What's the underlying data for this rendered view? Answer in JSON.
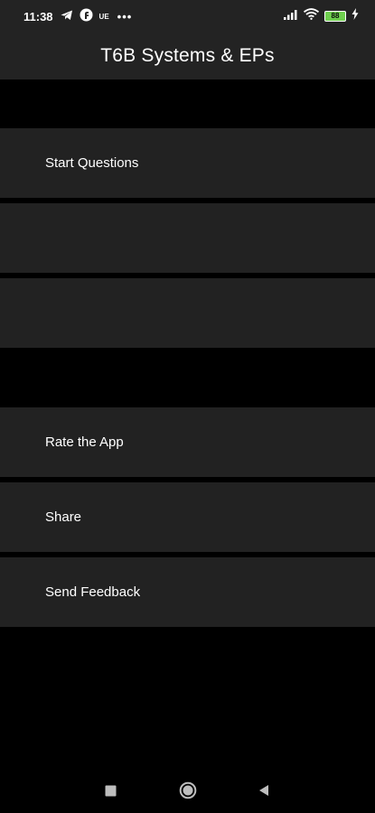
{
  "status_bar": {
    "time": "11:38",
    "carrier": "UE",
    "dots": "•••",
    "battery": "88"
  },
  "app_bar": {
    "title": "T6B Systems & EPs"
  },
  "menu": {
    "items": [
      {
        "label": "Start Questions"
      },
      {
        "label": ""
      },
      {
        "label": ""
      },
      {
        "label": "Rate the App"
      },
      {
        "label": "Share"
      },
      {
        "label": "Send Feedback"
      }
    ]
  },
  "icons": {
    "telegram": "telegram-icon",
    "app_f": "f-app-icon",
    "signal": "signal-icon",
    "wifi": "wifi-icon",
    "battery": "battery-icon",
    "charging": "charging-icon",
    "recents": "recents-icon",
    "home": "home-icon",
    "back": "back-icon"
  },
  "colors": {
    "background": "#000000",
    "bar": "#232323",
    "item": "#222222",
    "text": "#ffffff",
    "battery_fill": "#6fcf4f"
  }
}
